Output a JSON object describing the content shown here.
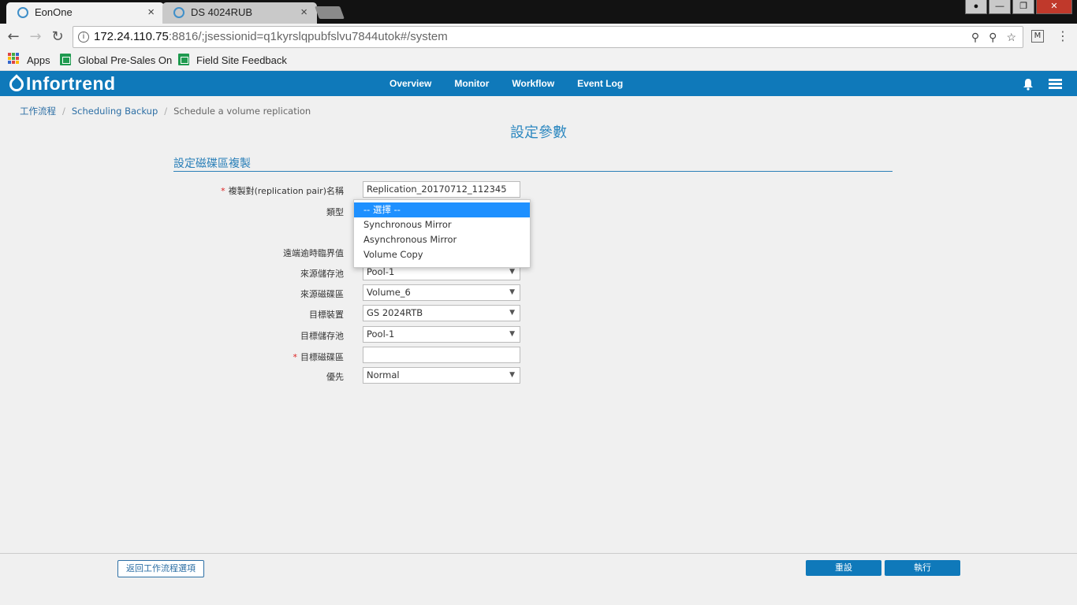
{
  "browser": {
    "tabs": [
      {
        "title": "EonOne",
        "close": "×"
      },
      {
        "title": "DS 4024RUB",
        "close": "×"
      }
    ],
    "url_host": "172.24.110.75",
    "url_rest": ":8816/;jsessionid=q1kyrslqpubfslvu7844utok#/system",
    "bookmarks": [
      "Apps",
      "Global Pre-Sales On",
      "Field Site Feedback"
    ]
  },
  "app": {
    "logo": "Infortrend",
    "nav": [
      "Overview",
      "Monitor",
      "Workflow",
      "Event Log"
    ]
  },
  "breadcrumb": [
    "工作流程",
    "Scheduling Backup",
    "Schedule a volume replication"
  ],
  "page_title": "設定參數",
  "section_title": "設定磁碟區複製",
  "form": {
    "name_label": "複製對(replication pair)名稱",
    "name_value": "Replication_20170712_112345",
    "type_label": "類型",
    "timeout_label": "遠端逾時臨界值",
    "source_pool_label": "來源儲存池",
    "source_pool_value": "Pool-1",
    "source_volume_label": "來源磁碟區",
    "source_volume_value": "Volume_6",
    "target_device_label": "目標裝置",
    "target_device_value": "GS 2024RTB",
    "target_pool_label": "目標儲存池",
    "target_pool_value": "Pool-1",
    "target_volume_label": "目標磁碟區",
    "target_volume_value": "",
    "priority_label": "優先",
    "priority_value": "Normal"
  },
  "type_dropdown": {
    "options": [
      "-- 選擇 --",
      "Synchronous Mirror",
      "Asynchronous Mirror",
      "Volume Copy"
    ]
  },
  "footer": {
    "back_label": "返回工作流程選項",
    "reset_label": "重設",
    "execute_label": "執行"
  }
}
